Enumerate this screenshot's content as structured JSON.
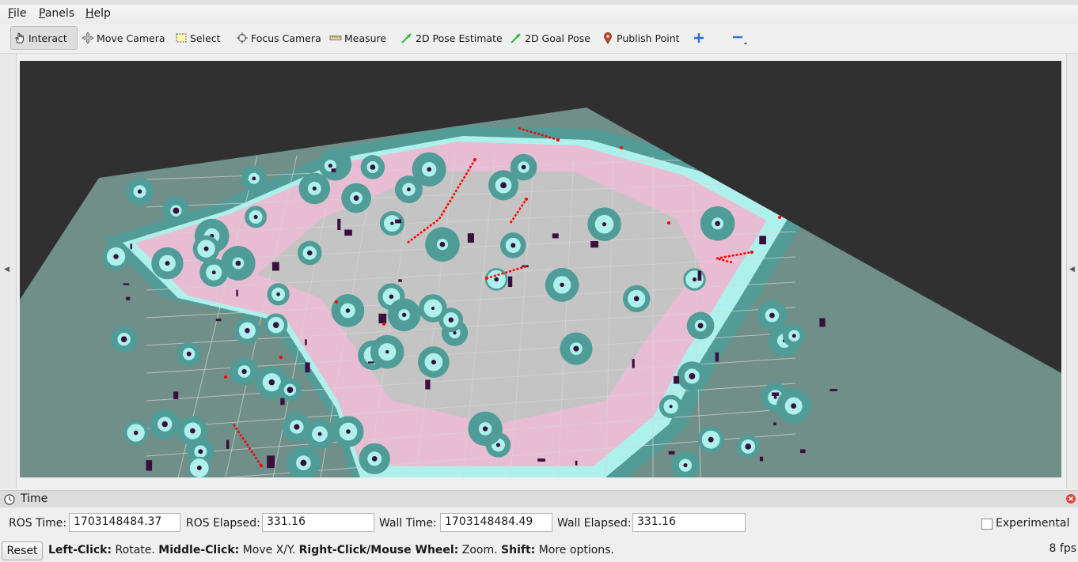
{
  "menu": [
    {
      "accel": "F",
      "rest": "ile"
    },
    {
      "accel": "P",
      "rest": "anels"
    },
    {
      "accel": "H",
      "rest": "elp"
    }
  ],
  "toolbar": {
    "interact": "Interact",
    "move_camera": "Move Camera",
    "select": "Select",
    "focus_camera": "Focus Camera",
    "measure": "Measure",
    "pose_estimate": "2D Pose Estimate",
    "goal_pose": "2D Goal Pose",
    "publish_point": "Publish Point"
  },
  "time_panel": {
    "title": "Time",
    "ros_time_label": "ROS Time:",
    "ros_time": "1703148484.37",
    "ros_elapsed_label": "ROS Elapsed:",
    "ros_elapsed": "331.16",
    "wall_time_label": "Wall Time:",
    "wall_time": "1703148484.49",
    "wall_elapsed_label": "Wall Elapsed:",
    "wall_elapsed": "331.16",
    "experimental_label": "Experimental"
  },
  "status": {
    "reset": "Reset",
    "h1b": "Left-Click:",
    "h1": " Rotate. ",
    "h2b": "Middle-Click:",
    "h2": " Move X/Y. ",
    "h3b": "Right-Click/Mouse Wheel:",
    "h3": " Zoom. ",
    "h4b": "Shift:",
    "h4": " More options.",
    "fps": "8 fps"
  },
  "colors": {
    "viewport_bg": "#303030",
    "map_floor": "#6f8f88",
    "free_space": "#c4c4c4",
    "inflation": "#e8bcd2",
    "obstacle_cyan": "#aef0ec",
    "lethal": "#3a0f3e",
    "laser": "#ff0000",
    "inflated_ring": "#4f9c98"
  }
}
